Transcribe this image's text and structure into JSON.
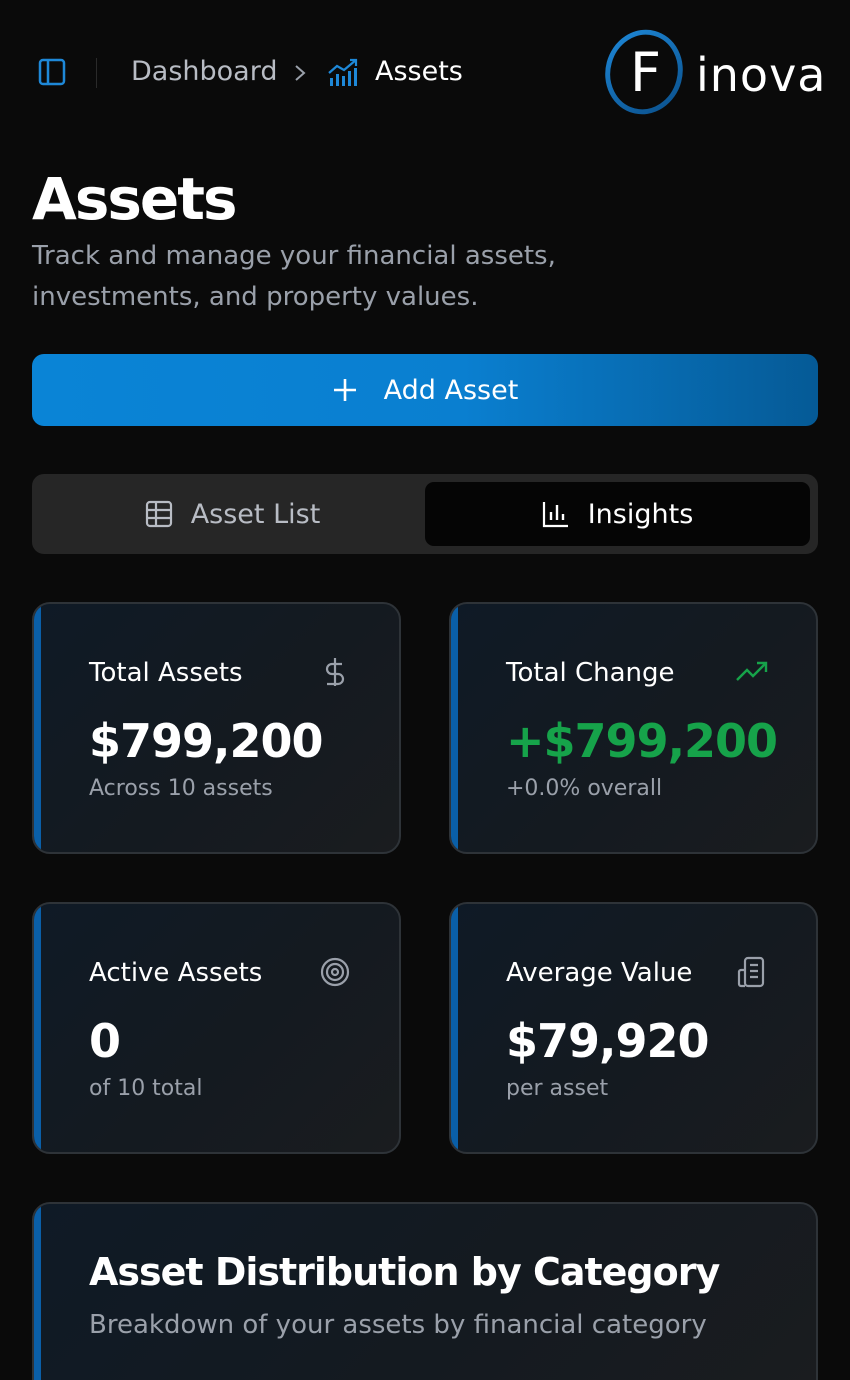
{
  "breadcrumb": {
    "dashboard": "Dashboard",
    "current": "Assets"
  },
  "logo": {
    "letter": "F",
    "text": "inova"
  },
  "page": {
    "title": "Assets",
    "subtitle": "Track and manage your financial assets, investments, and property values."
  },
  "add_button": {
    "label": "Add Asset"
  },
  "tabs": [
    {
      "label": "Asset List",
      "icon": "table-icon",
      "active": false
    },
    {
      "label": "Insights",
      "icon": "bar-chart-icon",
      "active": true
    }
  ],
  "stats": [
    {
      "label": "Total Assets",
      "value": "$799,200",
      "note": "Across 10 assets",
      "icon": "dollar-icon"
    },
    {
      "label": "Total Change",
      "value": "+$799,200",
      "note": "+0.0% overall",
      "icon": "trending-up-icon"
    },
    {
      "label": "Active Assets",
      "value": "0",
      "note": "of 10 total",
      "icon": "target-icon"
    },
    {
      "label": "Average Value",
      "value": "$79,920",
      "note": "per asset",
      "icon": "receipt-icon"
    }
  ],
  "distribution": {
    "title": "Asset Distribution by Category",
    "subtitle": "Breakdown of your assets by financial category"
  },
  "colors": {
    "accent": "#0a84d6",
    "positive": "#16a34a",
    "background": "#0a0a0a"
  }
}
